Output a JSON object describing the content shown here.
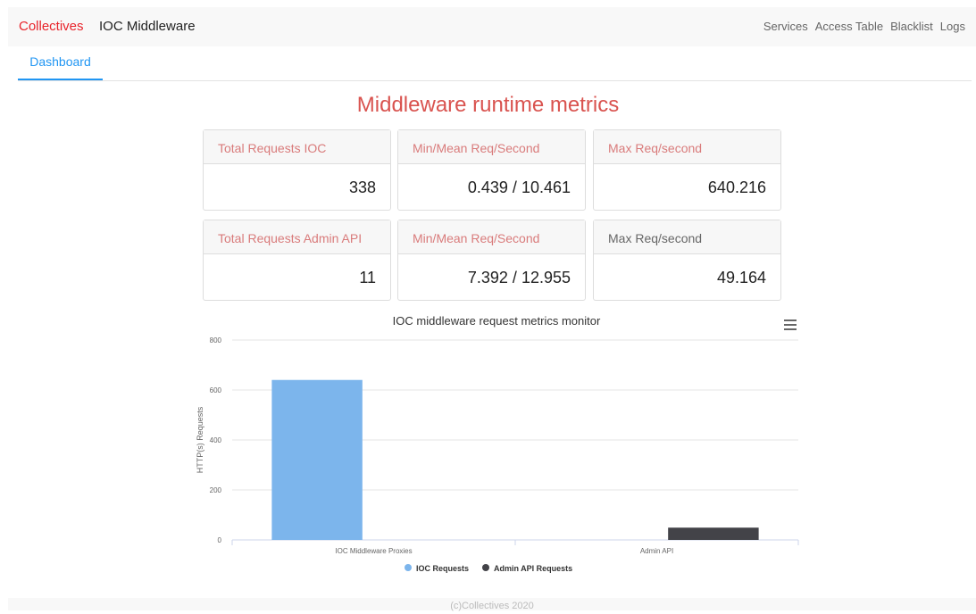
{
  "nav": {
    "brand": "Collectives",
    "title": "IOC Middleware",
    "links": [
      "Services",
      "Access Table",
      "Blacklist",
      "Logs"
    ]
  },
  "tabs": {
    "active": "Dashboard"
  },
  "heading": "Middleware runtime metrics",
  "cards": [
    {
      "label": "Total Requests IOC",
      "value": "338"
    },
    {
      "label": "Min/Mean Req/Second",
      "value": "0.439 / 10.461"
    },
    {
      "label": "Max Req/second",
      "value": "640.216"
    },
    {
      "label": "Total Requests Admin API",
      "value": "11"
    },
    {
      "label": "Min/Mean Req/Second",
      "value": "7.392 / 12.955"
    },
    {
      "label": "Max Req/second",
      "value": "49.164"
    }
  ],
  "chart_data": {
    "type": "bar",
    "title": "IOC middleware request metrics monitor",
    "categories": [
      "IOC Middleware Proxies",
      "Admin API"
    ],
    "series": [
      {
        "name": "IOC Requests",
        "color": "#7cb5ec",
        "values": [
          640.216,
          null
        ]
      },
      {
        "name": "Admin API Requests",
        "color": "#434348",
        "values": [
          null,
          49.164
        ]
      }
    ],
    "ylabel": "HTTP(s) Requests",
    "ylim": [
      0,
      800
    ],
    "yticks": [
      0,
      200,
      400,
      600,
      800
    ],
    "grid": true,
    "legend": "bottom-center"
  },
  "footer": "(c)Collectives 2020"
}
